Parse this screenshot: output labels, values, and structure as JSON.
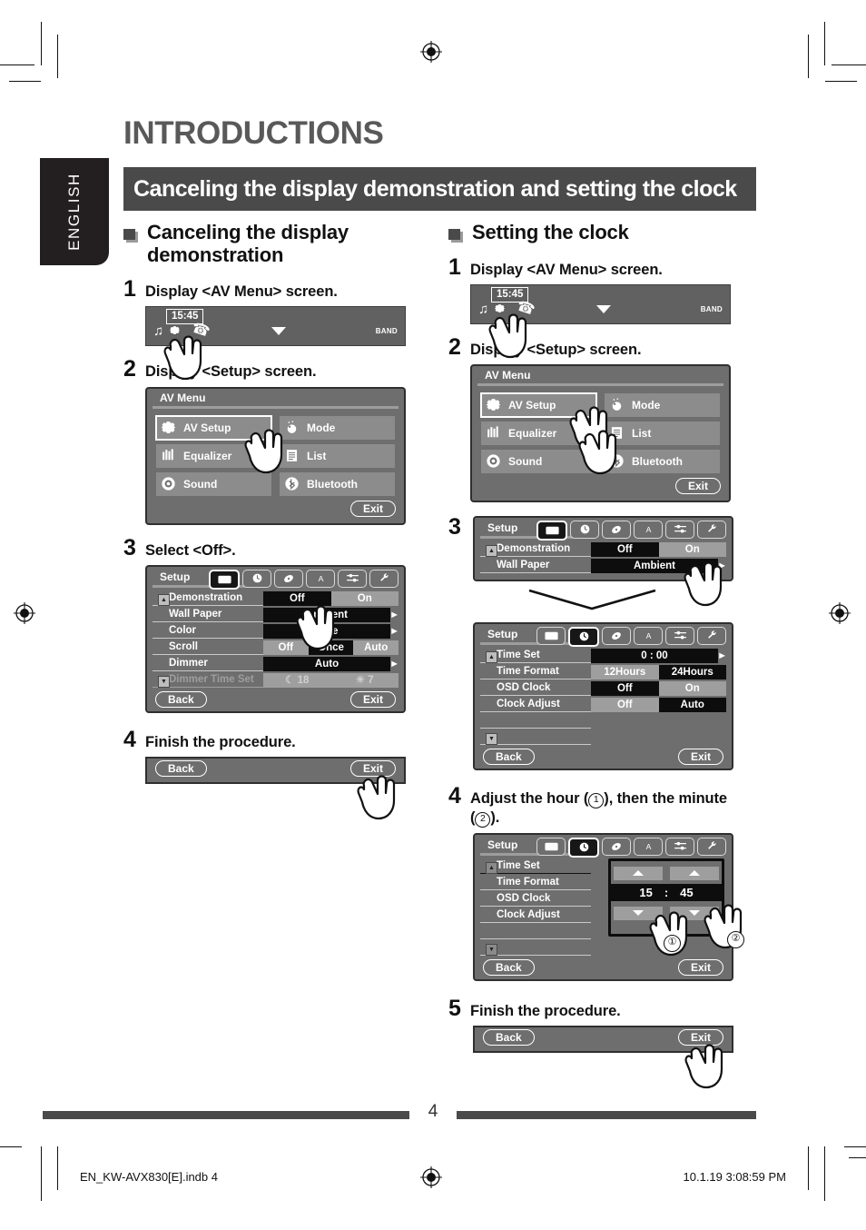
{
  "page": {
    "chapter_title": "INTRODUCTIONS",
    "section_banner": "Canceling the display demonstration and setting the clock",
    "language_tab": "ENGLISH",
    "page_number": "4",
    "footer_left": "EN_KW-AVX830[E].indb   4",
    "footer_right": "10.1.19   3:08:59 PM"
  },
  "left_column": {
    "heading": "Canceling the display demonstration",
    "steps": [
      {
        "num": "1",
        "text": "Display <AV Menu> screen."
      },
      {
        "num": "2",
        "text": "Display <Setup> screen."
      },
      {
        "num": "3",
        "text": "Select <Off>."
      },
      {
        "num": "4",
        "text": "Finish the procedure."
      }
    ],
    "topbar": {
      "clock": "15:45",
      "band_label": "BAND"
    },
    "av_menu": {
      "title": "AV Menu",
      "buttons": [
        {
          "label": "AV Setup",
          "icon": "gear-icon",
          "selected": true
        },
        {
          "label": "Mode",
          "icon": "mode-dial-icon",
          "selected": false
        },
        {
          "label": "Equalizer",
          "icon": "equalizer-bars-icon",
          "selected": false
        },
        {
          "label": "List",
          "icon": "list-icon",
          "selected": false
        },
        {
          "label": "Sound",
          "icon": "sound-disc-icon",
          "selected": false
        },
        {
          "label": "Bluetooth",
          "icon": "bluetooth-icon",
          "selected": false
        }
      ],
      "exit_label": "Exit"
    },
    "setup": {
      "title": "Setup",
      "tabs": [
        {
          "icon": "display-screen-icon",
          "active": true
        },
        {
          "icon": "clock-icon",
          "active": false
        },
        {
          "icon": "disc-icon",
          "active": false
        },
        {
          "icon": "font-a-icon",
          "active": false
        },
        {
          "icon": "mixer-sliders-icon",
          "active": false
        },
        {
          "icon": "wrench-icon",
          "active": false
        }
      ],
      "rows": [
        {
          "label": "Demonstration",
          "values": [
            "Off",
            "On"
          ],
          "selected": 0,
          "has_arrow": false
        },
        {
          "label": "Wall Paper",
          "values": [
            "Ambient"
          ],
          "selected": 0,
          "has_arrow": true
        },
        {
          "label": "Color",
          "values": [
            "Blue"
          ],
          "selected": 0,
          "has_arrow": true
        },
        {
          "label": "Scroll",
          "values": [
            "Off",
            "Once",
            "Auto"
          ],
          "selected": 1,
          "has_arrow": false
        },
        {
          "label": "Dimmer",
          "values": [
            "Auto"
          ],
          "selected": 0,
          "has_arrow": true
        },
        {
          "label": "Dimmer Time Set",
          "values": [
            "18",
            "7"
          ],
          "selected": -1,
          "has_arrow": false,
          "dim": true
        }
      ],
      "back_label": "Back",
      "exit_label": "Exit"
    },
    "finish_strip": {
      "back_label": "Back",
      "exit_label": "Exit"
    }
  },
  "right_column": {
    "heading": "Setting the clock",
    "steps": [
      {
        "num": "1",
        "text": "Display <AV Menu> screen."
      },
      {
        "num": "2",
        "text": "Display <Setup> screen."
      },
      {
        "num": "3",
        "text": ""
      },
      {
        "num": "4",
        "text": "Adjust the hour (①), then the minute (②)."
      },
      {
        "num": "5",
        "text": "Finish the procedure."
      }
    ],
    "step4_text_a": "Adjust the hour (",
    "step4_text_b": "), then the minute",
    "step4_text_c": "(",
    "step4_text_d": ").",
    "topbar": {
      "clock": "15:45",
      "band_label": "BAND"
    },
    "av_menu": {
      "title": "AV Menu",
      "buttons": [
        {
          "label": "AV Setup",
          "icon": "gear-icon",
          "selected": true
        },
        {
          "label": "Mode",
          "icon": "mode-dial-icon",
          "selected": false
        },
        {
          "label": "Equalizer",
          "icon": "equalizer-bars-icon",
          "selected": false
        },
        {
          "label": "List",
          "icon": "list-icon",
          "selected": false
        },
        {
          "label": "Sound",
          "icon": "sound-disc-icon",
          "selected": false
        },
        {
          "label": "Bluetooth",
          "icon": "bluetooth-icon",
          "selected": false
        }
      ],
      "exit_label": "Exit"
    },
    "setup_display": {
      "title": "Setup",
      "rows": [
        {
          "label": "Demonstration",
          "values": [
            "Off",
            "On"
          ],
          "selected": 0
        },
        {
          "label": "Wall Paper",
          "values": [
            "Ambient"
          ],
          "selected": 0
        }
      ]
    },
    "setup_clock": {
      "title": "Setup",
      "rows": [
        {
          "label": "Time Set",
          "values": [
            "0 : 00"
          ],
          "selected": 0,
          "has_arrow": true
        },
        {
          "label": "Time Format",
          "values": [
            "12Hours",
            "24Hours"
          ],
          "selected": 1,
          "has_arrow": false
        },
        {
          "label": "OSD Clock",
          "values": [
            "Off",
            "On"
          ],
          "selected": 0,
          "has_arrow": false
        },
        {
          "label": "Clock Adjust",
          "values": [
            "Off",
            "Auto"
          ],
          "selected": 1,
          "has_arrow": false
        }
      ],
      "back_label": "Back",
      "exit_label": "Exit"
    },
    "setup_timeset": {
      "title": "Setup",
      "rows": [
        "Time Set",
        "Time Format",
        "OSD Clock",
        "Clock Adjust"
      ],
      "hour": "15",
      "separator": ":",
      "minute": "45",
      "marker_1": "①",
      "marker_2": "②",
      "back_label": "Back",
      "exit_label": "Exit"
    },
    "finish_strip": {
      "back_label": "Back",
      "exit_label": "Exit"
    }
  },
  "colors": {
    "banner_bg": "#4a4a4a",
    "panel_bg": "#6e6e6e",
    "chip_on": "#0d0d0d",
    "chip_off": "#9e9e9e",
    "tab_dark": "#231f20"
  }
}
